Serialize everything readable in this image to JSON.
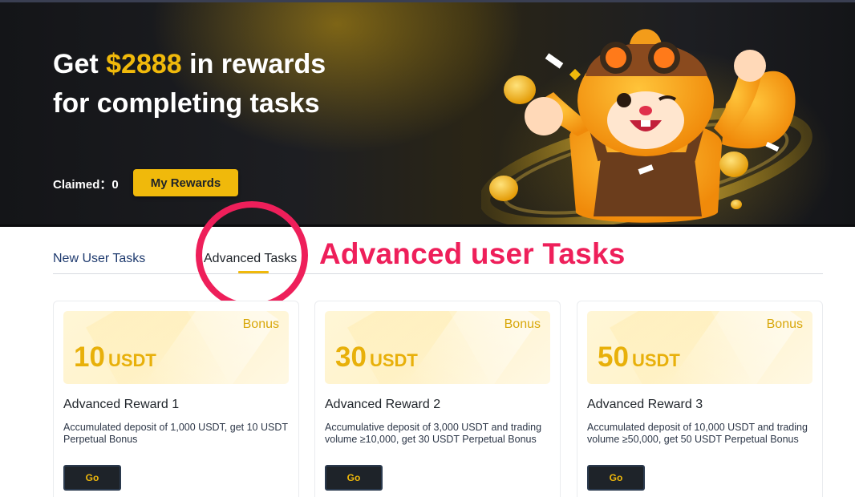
{
  "hero": {
    "title_prefix": "Get ",
    "title_amount": "$2888",
    "title_suffix": " in rewards",
    "title_line2": "for completing tasks",
    "claimed_label": "Claimed：",
    "claimed_value": "0",
    "my_rewards_label": "My Rewards",
    "accent_color": "#f0b90b"
  },
  "tabs": [
    {
      "label": "New User Tasks",
      "active": false
    },
    {
      "label": "Advanced Tasks",
      "active": true
    }
  ],
  "annotation": {
    "text": "Advanced user Tasks",
    "color": "#ee1f5a"
  },
  "cards": [
    {
      "bonus_label": "Bonus",
      "amount": "10",
      "unit": "USDT",
      "title": "Advanced Reward 1",
      "description": "Accumulated deposit of 1,000 USDT, get 10 USDT Perpetual Bonus",
      "button_label": "Go"
    },
    {
      "bonus_label": "Bonus",
      "amount": "30",
      "unit": "USDT",
      "title": "Advanced Reward 2",
      "description": "Accumulative deposit of 3,000 USDT and trading volume ≥10,000, get 30 USDT Perpetual Bonus",
      "button_label": "Go"
    },
    {
      "bonus_label": "Bonus",
      "amount": "50",
      "unit": "USDT",
      "title": "Advanced Reward 3",
      "description": "Accumulated deposit of 10,000 USDT and trading volume ≥50,000, get 50 USDT Perpetual Bonus",
      "button_label": "Go"
    }
  ]
}
